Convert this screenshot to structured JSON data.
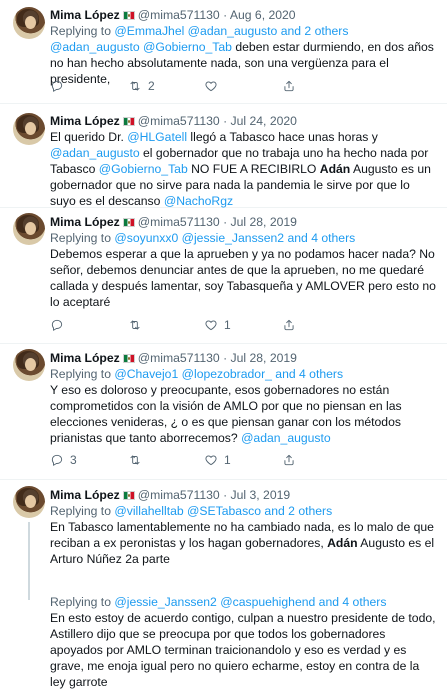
{
  "tweets": [
    {
      "name": "Mima López",
      "handle": "@mima571130",
      "date": "· Aug 6, 2020",
      "reply_prefix": "Replying to ",
      "reply_mentions": "@EmmaJhel @adan_augusto and 2 others",
      "body_parts": [
        {
          "text": "@adan_augusto @Gobierno_Tab",
          "mention": true
        },
        {
          "text": " deben estar durmiendo, en dos años no han hecho absolutamente nada, son una vergüenza para el presidente,"
        }
      ],
      "replies": "",
      "retweets": "2",
      "likes": "",
      "show_actions": true
    },
    {
      "name": "Mima López",
      "handle": "@mima571130",
      "date": "· Jul 24, 2020",
      "reply_prefix": "",
      "reply_mentions": "",
      "body_parts": [
        {
          "text": "El querido Dr. "
        },
        {
          "text": "@HLGatell",
          "mention": true
        },
        {
          "text": " llegó a Tabasco hace unas horas y "
        },
        {
          "text": "@adan_augusto",
          "mention": true
        },
        {
          "text": " el gobernador que no trabaja uno ha hecho nada por Tabasco "
        },
        {
          "text": "@Gobierno_Tab",
          "mention": true
        },
        {
          "text": " NO FUE A RECIBIRLO "
        },
        {
          "text": "Adán",
          "bold": true
        },
        {
          "text": " Augusto es un gobernador que no sirve para nada la pandemia le sirve por que lo suyo es el descanso "
        },
        {
          "text": "@NachoRgz",
          "mention": true
        }
      ],
      "show_actions": false
    },
    {
      "name": "Mima López",
      "handle": "@mima571130",
      "date": "· Jul 28, 2019",
      "reply_prefix": "Replying to ",
      "reply_mentions": "@soyunxx0 @jessie_Janssen2 and 4 others",
      "body_parts": [
        {
          "text": "Debemos esperar a que la aprueben y ya no podamos hacer nada? No señor, debemos denunciar antes de que la aprueben, no me quedaré callada y después lamentar, soy Tabasqueña y AMLOVER pero esto no lo aceptaré"
        }
      ],
      "replies": "",
      "retweets": "",
      "likes": "1",
      "show_actions": true
    },
    {
      "name": "Mima López",
      "handle": "@mima571130",
      "date": "· Jul 28, 2019",
      "reply_prefix": "Replying to ",
      "reply_mentions": "@Chavejo1 @lopezobrador_ and 4 others",
      "body_parts": [
        {
          "text": "Y eso es doloroso y preocupante, esos gobernadores no están comprometidos con la visión de AMLO por que no piensan en las elecciones venideras, ¿ o es que piensan ganar con los métodos prianistas que tanto aborrecemos? "
        },
        {
          "text": "@adan_augusto",
          "mention": true
        }
      ],
      "replies": "3",
      "retweets": "",
      "likes": "1",
      "show_actions": true
    },
    {
      "name": "Mima López",
      "handle": "@mima571130",
      "date": "· Jul 3, 2019",
      "reply_prefix": "Replying to ",
      "reply_mentions": "@villahelltab @SETabasco and 2 others",
      "body_parts": [
        {
          "text": "En Tabasco lamentablemente no ha cambiado nada, es lo malo de que reciban a ex peronistas y los hagan gobernadores, "
        },
        {
          "text": "Adán",
          "bold": true
        },
        {
          "text": " Augusto es el Arturo Núñez 2a parte"
        }
      ],
      "show_actions": false
    },
    {
      "name": "",
      "handle": "",
      "date": "",
      "reply_prefix": "Replying to ",
      "reply_mentions": "@jessie_Janssen2 @caspuehighend and 4 others",
      "body_parts": [
        {
          "text": "En esto estoy de acuerdo contigo,  culpan a nuestro presidente de todo, Astillero dijo que se preocupa por que todos los gobernadores apoyados por AMLO terminan traicionandolo y eso es verdad y es grave, me enoja igual pero no quiero echarme, estoy en contra de la ley garrote"
        }
      ],
      "show_actions": false
    }
  ]
}
